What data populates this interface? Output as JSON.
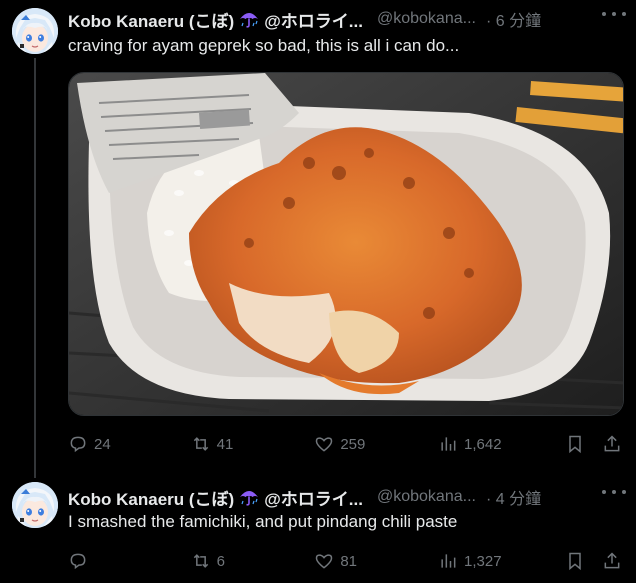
{
  "tweets": [
    {
      "display_name": "Kobo Kanaeru (こぼ)",
      "name_suffix": "@ホロライ...",
      "handle": "@kobokana...",
      "time": "· 6 分鐘",
      "text": "craving for ayam geprek so bad, this is all i can do...",
      "stats": {
        "replies": "24",
        "retweets": "41",
        "likes": "259",
        "views": "1,642"
      }
    },
    {
      "display_name": "Kobo Kanaeru (こぼ)",
      "name_suffix": "@ホロライ...",
      "handle": "@kobokana...",
      "time": "· 4 分鐘",
      "text": "I smashed the famichiki, and put pindang chili paste",
      "stats": {
        "replies": "",
        "retweets": "6",
        "likes": "81",
        "views": "1,327"
      }
    }
  ],
  "icons": {
    "name_badge": "umbrella-icon",
    "reply": "reply-icon",
    "retweet": "retweet-icon",
    "like": "heart-icon",
    "views": "views-icon",
    "bookmark": "bookmark-icon",
    "share": "share-icon",
    "more": "more-icon"
  },
  "colors": {
    "background": "#000000",
    "text": "#e7e9ea",
    "secondary": "#71767b",
    "badge": "#8b5cf6"
  }
}
